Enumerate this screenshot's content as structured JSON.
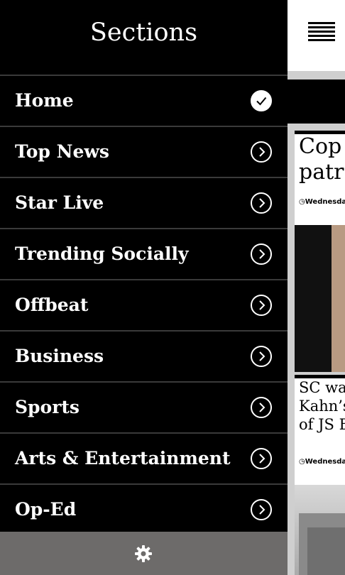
{
  "sidebar": {
    "title": "Sections",
    "items": [
      {
        "label": "Home",
        "icon": "check-circle-icon",
        "selected": true
      },
      {
        "label": "Top News",
        "icon": "chevron-right-circle-icon",
        "selected": false
      },
      {
        "label": "Star Live",
        "icon": "chevron-right-circle-icon",
        "selected": false
      },
      {
        "label": "Trending Socially",
        "icon": "chevron-right-circle-icon",
        "selected": false
      },
      {
        "label": "Offbeat",
        "icon": "chevron-right-circle-icon",
        "selected": false
      },
      {
        "label": "Business",
        "icon": "chevron-right-circle-icon",
        "selected": false
      },
      {
        "label": "Sports",
        "icon": "chevron-right-circle-icon",
        "selected": false
      },
      {
        "label": "Arts & Entertainment",
        "icon": "chevron-right-circle-icon",
        "selected": false
      },
      {
        "label": "Op-Ed",
        "icon": "chevron-right-circle-icon",
        "selected": false
      }
    ],
    "footer_icon": "gear-icon"
  },
  "background": {
    "menu_icon": "hamburger-icon",
    "articles": [
      {
        "title_line1": "Cop l",
        "title_line2": "patro",
        "date": "Wednesday"
      },
      {
        "title_line1": "SC war",
        "title_line2": "Kahn’s",
        "title_line3": "of JS B",
        "date": "Wednesday"
      }
    ]
  },
  "colors": {
    "sidebar_bg": "#000000",
    "divider": "#3a3a3a",
    "footer_bg": "#6d6b6a",
    "text": "#ffffff"
  }
}
